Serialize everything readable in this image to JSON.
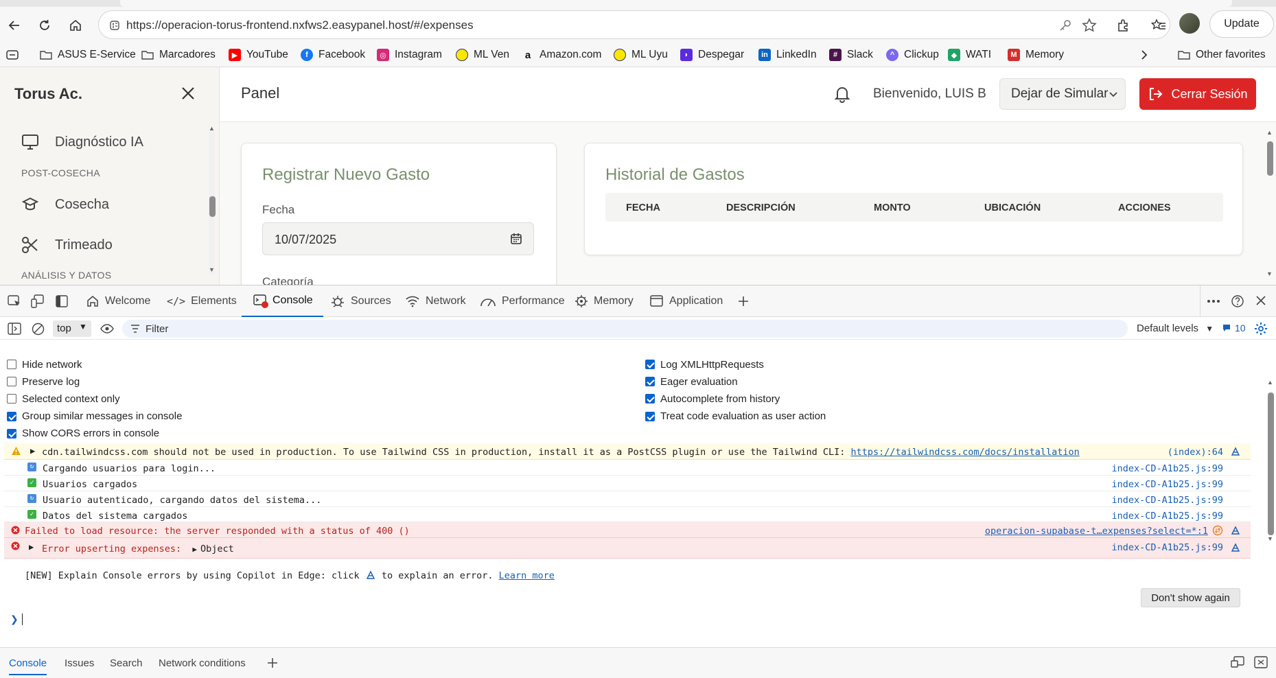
{
  "browser": {
    "url": "https://operacion-torus-frontend.nxfws2.easypanel.host/#/expenses",
    "update_label": "Update",
    "bookmarks": [
      {
        "label": "ASUS E-Service",
        "icon": "folder-icon"
      },
      {
        "label": "Marcadores",
        "icon": "folder-icon"
      },
      {
        "label": "YouTube",
        "icon": "youtube-icon",
        "color": "#ff0000"
      },
      {
        "label": "Facebook",
        "icon": "facebook-icon",
        "color": "#1877f2"
      },
      {
        "label": "Instagram",
        "icon": "instagram-icon",
        "color": "#d62976"
      },
      {
        "label": "ML Ven",
        "icon": "mercadolibre-icon",
        "color": "#ffe600"
      },
      {
        "label": "Amazon.com",
        "icon": "amazon-icon",
        "color": "#111111"
      },
      {
        "label": "ML Uyu",
        "icon": "mercadolibre-icon",
        "color": "#ffe600"
      },
      {
        "label": "Despegar",
        "icon": "despegar-icon",
        "color": "#5b2be0"
      },
      {
        "label": "LinkedIn",
        "icon": "linkedin-icon",
        "color": "#0a66c2"
      },
      {
        "label": "Slack",
        "icon": "slack-icon",
        "color": "#4a154b"
      },
      {
        "label": "Clickup",
        "icon": "clickup-icon",
        "color": "#7b68ee"
      },
      {
        "label": "WATI",
        "icon": "wati-icon",
        "color": "#21a366"
      },
      {
        "label": "Memory",
        "icon": "memory-icon",
        "color": "#d32f2f"
      }
    ],
    "other_favorites": "Other favorites"
  },
  "app": {
    "brand": "Torus Ac.",
    "sidebar": {
      "item_diagnostico": "Diagnóstico IA",
      "section_postcosecha": "POST-COSECHA",
      "item_cosecha": "Cosecha",
      "item_trimeado": "Trimeado",
      "section_analisis": "ANÁLISIS Y DATOS"
    },
    "header": {
      "title": "Panel",
      "welcome": "Bienvenido, LUIS B",
      "simulate_select": "Dejar de Simular",
      "logout": "Cerrar Sesión"
    },
    "register_card": {
      "title": "Registrar Nuevo Gasto",
      "fecha_label": "Fecha",
      "fecha_value": "10/07/2025",
      "categoria_label": "Categoría"
    },
    "history_card": {
      "title": "Historial de Gastos",
      "columns": [
        "FECHA",
        "DESCRIPCIÓN",
        "MONTO",
        "UBICACIÓN",
        "ACCIONES"
      ]
    }
  },
  "devtools": {
    "tabs": [
      "Welcome",
      "Elements",
      "Console",
      "Sources",
      "Network",
      "Performance",
      "Memory",
      "Application"
    ],
    "context": "top",
    "filter_placeholder": "Filter",
    "levels": "Default levels",
    "issues_count": "10",
    "settings_left": [
      "Hide network",
      "Preserve log",
      "Selected context only",
      "Group similar messages in console",
      "Show CORS errors in console"
    ],
    "settings_left_checked": [
      false,
      false,
      false,
      true,
      true
    ],
    "settings_right": [
      "Log XMLHttpRequests",
      "Eager evaluation",
      "Autocomplete from history",
      "Treat code evaluation as user action"
    ],
    "settings_right_checked": [
      true,
      true,
      true,
      true
    ],
    "messages": {
      "warn": {
        "text": "cdn.tailwindcss.com should not be used in production. To use Tailwind CSS in production, install it as a PostCSS plugin or use the Tailwind CLI: ",
        "link": "https://tailwindcss.com/docs/installation",
        "source": "(index):64"
      },
      "log1": {
        "text": "Cargando usuarios para login...",
        "source": "index-CD-A1b25.js:99"
      },
      "log2": {
        "text": "Usuarios cargados",
        "source": "index-CD-A1b25.js:99"
      },
      "log3": {
        "text": "Usuario autenticado, cargando datos del sistema...",
        "source": "index-CD-A1b25.js:99"
      },
      "log4": {
        "text": "Datos del sistema cargados",
        "source": "index-CD-A1b25.js:99"
      },
      "err1": {
        "text": "Failed to load resource: the server responded with a status of 400 ()",
        "source": "operacion-supabase-t…expenses?select=*:1"
      },
      "err2": {
        "text": "Error upserting expenses: ",
        "object": "Object",
        "source": "index-CD-A1b25.js:99"
      },
      "copilot": {
        "text_before": "[NEW] Explain Console errors by using Copilot in Edge: click ",
        "text_after": " to explain an error. ",
        "link": "Learn more",
        "button": "Don't show again"
      }
    },
    "drawer_tabs": [
      "Console",
      "Issues",
      "Search",
      "Network conditions"
    ]
  }
}
